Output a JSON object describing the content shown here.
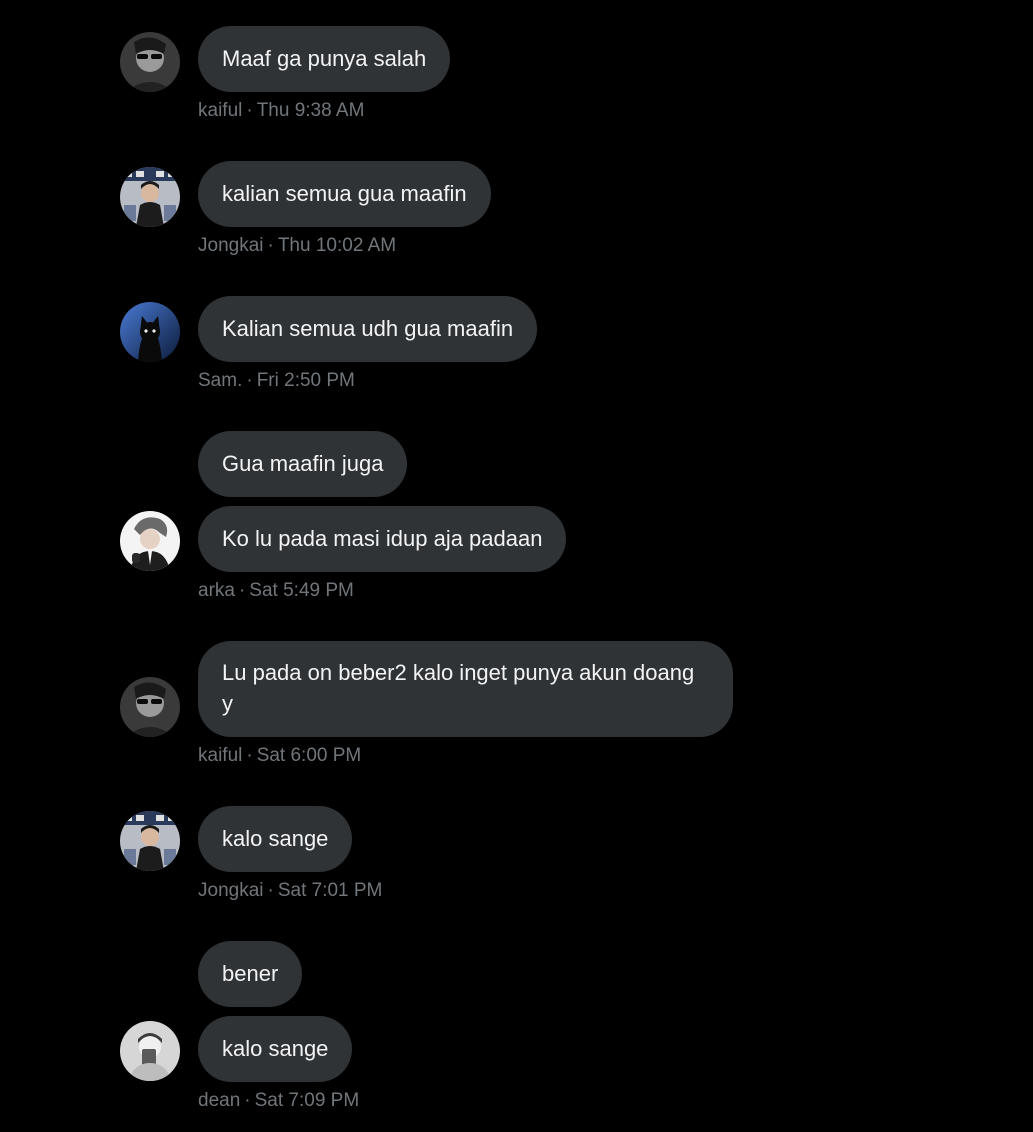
{
  "colors": {
    "background": "#000000",
    "bubble": "#2f3336",
    "bubble_text": "#f2f3f4",
    "meta_text": "#71767b"
  },
  "messages": [
    {
      "text": "Maaf ga punya salah",
      "avatar": "kaiful-avatar"
    },
    {
      "text": "kalian semua gua maafin",
      "avatar": "jongkai-avatar"
    },
    {
      "text": "Kalian semua udh gua maafin",
      "avatar": "sam-avatar"
    },
    {
      "text": "Gua maafin juga"
    },
    {
      "text": "Ko lu pada masi idup aja padaan",
      "avatar": "arka-avatar"
    },
    {
      "text": "Lu pada on beber2 kalo inget punya akun doang y",
      "avatar": "kaiful-avatar"
    },
    {
      "text": "kalo sange",
      "avatar": "jongkai-avatar"
    },
    {
      "text": "bener"
    },
    {
      "text": "kalo sange",
      "avatar": "dean-avatar"
    }
  ],
  "meta": [
    {
      "name": "kaiful",
      "sep": "·",
      "time": "Thu 9:38 AM"
    },
    {
      "name": "Jongkai",
      "sep": "·",
      "time": "Thu 10:02 AM"
    },
    {
      "name": "Sam.",
      "sep": "·",
      "time": "Fri 2:50 PM"
    },
    {
      "name": "arka",
      "sep": "·",
      "time": "Sat 5:49 PM"
    },
    {
      "name": "kaiful",
      "sep": "·",
      "time": "Sat 6:00 PM"
    },
    {
      "name": "Jongkai",
      "sep": "·",
      "time": "Sat 7:01 PM"
    },
    {
      "name": "dean",
      "sep": "·",
      "time": "Sat 7:09 PM"
    }
  ]
}
